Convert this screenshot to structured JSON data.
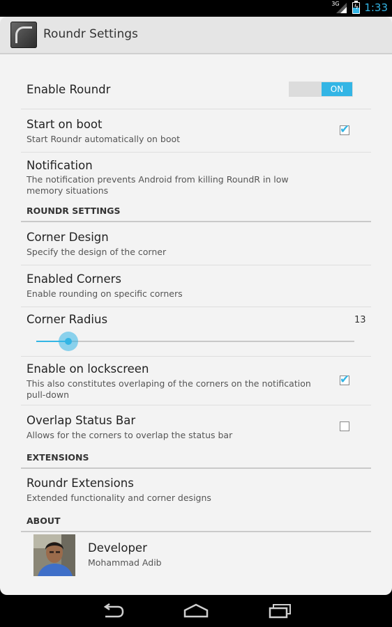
{
  "status_bar": {
    "signal_label": "3G",
    "time": "1:33",
    "battery_level": 0.5
  },
  "action_bar": {
    "title": "Roundr Settings"
  },
  "prefs": {
    "enable_roundr": {
      "title": "Enable Roundr",
      "toggle_label": "ON"
    },
    "start_on_boot": {
      "title": "Start on boot",
      "summary": "Start Roundr automatically on boot",
      "checked": true
    },
    "notification": {
      "title": "Notification",
      "summary": "The notification prevents Android from killing RoundR in low memory situations"
    },
    "roundr_settings_header": "ROUNDR SETTINGS",
    "corner_design": {
      "title": "Corner Design",
      "summary": "Specify the design of the corner"
    },
    "enabled_corners": {
      "title": "Enabled Corners",
      "summary": "Enable rounding on specific corners"
    },
    "corner_radius": {
      "title": "Corner Radius",
      "value": "13",
      "fraction": 0.1
    },
    "enable_lockscreen": {
      "title": "Enable on lockscreen",
      "summary": "This also constitutes overlaping of the corners on the notification pull-down",
      "checked": true
    },
    "overlap_status_bar": {
      "title": "Overlap Status Bar",
      "summary": "Allows for the corners to overlap the status bar",
      "checked": false
    },
    "extensions_header": "EXTENSIONS",
    "roundr_extensions": {
      "title": "Roundr Extensions",
      "summary": "Extended functionality and corner designs"
    },
    "about_header": "ABOUT",
    "developer": {
      "title": "Developer",
      "summary": "Mohammad Adib"
    }
  },
  "nav_bar": {
    "icons": [
      "back-icon",
      "home-icon",
      "recent-apps-icon"
    ]
  },
  "colors": {
    "accent": "#33b5e5",
    "background": "#f3f3f3",
    "action_bar": "#e5e5e5"
  }
}
